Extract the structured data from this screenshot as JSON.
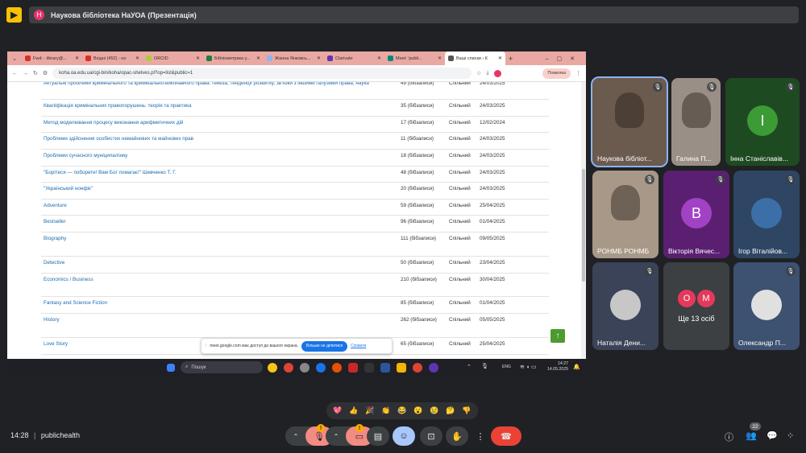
{
  "meeting": {
    "title": "Наукова бібліотека НаУОА (Презентація)",
    "avatar_letter": "Н",
    "clock": "14:28",
    "room": "publichealth",
    "participant_count": "22",
    "more_label": "Ще 13 осіб"
  },
  "browser": {
    "tabs": [
      {
        "label": "Fwd: - library@...",
        "color": "#d93025"
      },
      {
        "label": "Вхідні (452) - оо",
        "color": "#d93025"
      },
      {
        "label": "ORCID",
        "color": "#a6ce39"
      },
      {
        "label": "Бібліометрика у...",
        "color": "#188038"
      },
      {
        "label": "Жанна Янковсь...",
        "color": "#8ab4f8"
      },
      {
        "label": "Clarivate",
        "color": "#5e35b1"
      },
      {
        "label": "Meet: 'publi...",
        "color": "#00897b"
      },
      {
        "label": "Ваші списки › К",
        "color": "#555555"
      }
    ],
    "url": "koha.oa.edu.ua/cgi-bin/koha/opac-shelves.pl?op=list&public=1",
    "pause_label": "Помилка"
  },
  "shelves": [
    {
      "title": "Актуальні проблеми кримінального та кримінально-виконавчого права: генеза, тенденції розвитку, зв'язки з іншими галузями права, наука",
      "count": "49 (бібзаписи)",
      "type": "Спільний",
      "date": "24/03/2025"
    },
    {
      "title": "Кваліфікація кримінальних правопорушень: теорія та практика",
      "count": "35 (бібзаписи)",
      "type": "Спільний",
      "date": "24/03/2025"
    },
    {
      "title": "Метод моделювання процесу виконання арифметичних дій",
      "count": "17 (бібзаписи)",
      "type": "Спільний",
      "date": "12/02/2024"
    },
    {
      "title": "Проблеми здійснення особистих немайнових та майнових прав",
      "count": "11 (бібзаписи)",
      "type": "Спільний",
      "date": "24/03/2025"
    },
    {
      "title": "Проблеми сучасного муніципалізму",
      "count": "18 (бібзаписи)",
      "type": "Спільний",
      "date": "24/03/2025"
    },
    {
      "title": "\"Борітеся — поборете! Вам Бог помагає!\" Шевченко Т. Г.",
      "count": "48 (бібзаписи)",
      "type": "Спільний",
      "date": "24/03/2025"
    },
    {
      "title": "\"Український нонфік\"",
      "count": "20 (бібзаписи)",
      "type": "Спільний",
      "date": "24/03/2025"
    },
    {
      "title": "Adventure",
      "count": "59 (бібзаписи)",
      "type": "Спільний",
      "date": "25/04/2025"
    },
    {
      "title": "Bestseller",
      "count": "96 (бібзаписи)",
      "type": "Спільний",
      "date": "01/04/2025"
    },
    {
      "title": "Biography",
      "count": "111 (бібзаписи)",
      "type": "Спільний",
      "date": "09/05/2025"
    },
    {
      "title": "Detective",
      "count": "50 (бібзаписи)",
      "type": "Спільний",
      "date": "23/04/2025"
    },
    {
      "title": "Economics / Business",
      "count": "210 (бібзаписи)",
      "type": "Спільний",
      "date": "30/04/2025"
    },
    {
      "title": "Fantasy and Science Fiction",
      "count": "85 (бібзаписи)",
      "type": "Спільний",
      "date": "01/04/2025"
    },
    {
      "title": "History",
      "count": "262 (бібзаписи)",
      "type": "Спільний",
      "date": "05/05/2025"
    },
    {
      "title": "Love Story",
      "count": "65 (бібзаписи)",
      "type": "Спільний",
      "date": "25/04/2025"
    }
  ],
  "share_notice": {
    "text": "meet.google.com має доступ до вашого екрана.",
    "stop_label": "Більше не ділитися",
    "hide_label": "Сховати"
  },
  "taskbar": {
    "search_placeholder": "Пошук",
    "lang": "ENG",
    "time": "14:27",
    "date": "14.05.2025"
  },
  "participants": [
    {
      "name": "Наукова бібліот...",
      "kind": "video",
      "color": "#6b5a4e"
    },
    {
      "name": "Галина П...",
      "kind": "video",
      "color": "#9a8f86"
    },
    {
      "name": "Інна Станіславів...",
      "kind": "letter",
      "letter": "І",
      "color": "#3d9b35",
      "bg": "#1e4a22"
    },
    {
      "name": "РОНМБ РОНМБ",
      "kind": "video",
      "color": "#a89888"
    },
    {
      "name": "Вікторія Вячес...",
      "kind": "letter",
      "letter": "В",
      "color": "#a142c4",
      "bg": "#5b1f72"
    },
    {
      "name": "Ігор Віталійов...",
      "kind": "photo",
      "color": "#3c6fa8",
      "bg": "#2e4663"
    },
    {
      "name": "Наталія Дени...",
      "kind": "photo",
      "color": "#c7c7c7",
      "bg": "#3a4358"
    },
    {
      "name": "Ще 13 осіб",
      "kind": "more",
      "letters": [
        "О",
        "М"
      ],
      "colors": [
        "#e5395b",
        "#e5395b"
      ]
    },
    {
      "name": "Олександр П...",
      "kind": "photo",
      "color": "#e0e0e0",
      "bg": "#3d5170"
    }
  ],
  "reactions": [
    "💖",
    "👍",
    "🎉",
    "👏",
    "😂",
    "😮",
    "😢",
    "🤔",
    "👎"
  ]
}
